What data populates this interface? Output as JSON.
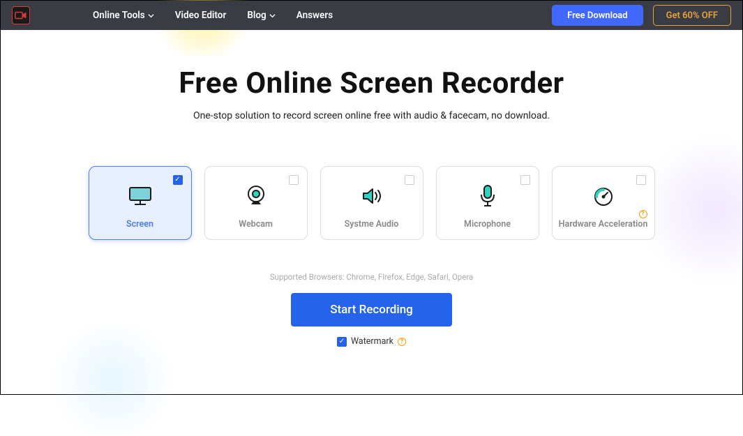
{
  "nav": {
    "items": [
      "Online Tools",
      "Video Editor",
      "Blog",
      "Answers"
    ],
    "has_dropdown": [
      true,
      false,
      true,
      false
    ],
    "download": "Free Download",
    "offer": "Get 60% OFF"
  },
  "hero": {
    "title": "Free Online Screen Recorder",
    "subtitle": "One-stop solution to record screen online free with audio & facecam, no download."
  },
  "cards": [
    {
      "id": "screen",
      "label": "Screen",
      "checked": true
    },
    {
      "id": "webcam",
      "label": "Webcam",
      "checked": false
    },
    {
      "id": "system-audio",
      "label": "Systme Audio",
      "checked": false
    },
    {
      "id": "microphone",
      "label": "Microphone",
      "checked": false
    },
    {
      "id": "hwaccel",
      "label": "Hardware Acceleration",
      "checked": false,
      "info": true
    }
  ],
  "support": "Supported Browsers: Chrome, Firefox, Edge, Safari, Opera",
  "cta": "Start Recording",
  "watermark": {
    "label": "Watermark",
    "checked": true
  }
}
